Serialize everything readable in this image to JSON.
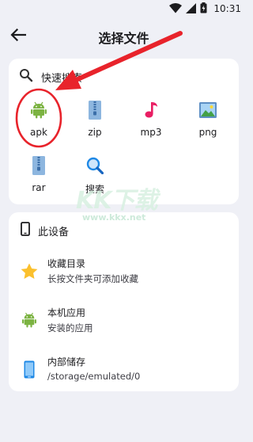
{
  "status_bar": {
    "time": "10:31",
    "icons": [
      "wifi-icon",
      "signal-icon",
      "battery-icon"
    ]
  },
  "app_bar": {
    "title": "选择文件",
    "back_icon": "arrow-back-icon"
  },
  "quick_search": {
    "header_label": "快速搜索",
    "header_icon": "search-icon",
    "items": [
      {
        "label": "apk",
        "icon": "android-icon",
        "color": "#7cb342"
      },
      {
        "label": "zip",
        "icon": "zip-file-icon",
        "color": "#78a6d6"
      },
      {
        "label": "mp3",
        "icon": "music-note-icon",
        "color": "#e91e63"
      },
      {
        "label": "png",
        "icon": "image-file-icon",
        "color": "#4caf50"
      },
      {
        "label": "rar",
        "icon": "rar-file-icon",
        "color": "#78a6d6"
      },
      {
        "label": "搜索",
        "icon": "magnifier-icon",
        "color": "#1e88e5"
      }
    ]
  },
  "device": {
    "header_label": "此设备",
    "header_icon": "phone-outline-icon",
    "items": [
      {
        "title": "收藏目录",
        "subtitle": "长按文件夹可添加收藏",
        "icon": "star-icon",
        "color": "#fbc02d"
      },
      {
        "title": "本机应用",
        "subtitle": "安装的应用",
        "icon": "android-icon",
        "color": "#7cb342"
      },
      {
        "title": "内部储存",
        "subtitle": "/storage/emulated/0",
        "icon": "phone-storage-icon",
        "color": "#1e88e5"
      }
    ]
  },
  "watermark": {
    "main": "KK下载",
    "sub": "www.kkx.net"
  },
  "colors": {
    "background": "#eff0f6",
    "card": "#ffffff",
    "annotation_red": "#e8232b"
  }
}
